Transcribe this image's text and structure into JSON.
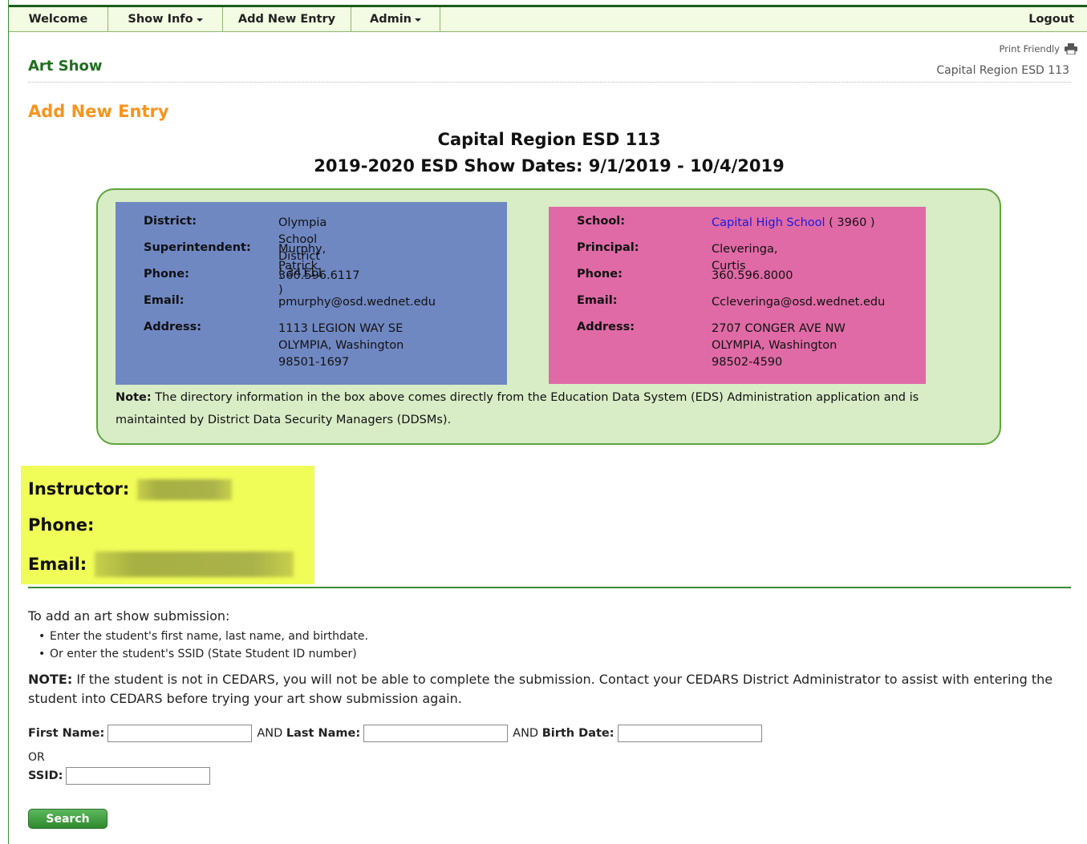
{
  "nav": {
    "welcome": "Welcome",
    "show_info": "Show Info",
    "add_new_entry": "Add New Entry",
    "admin": "Admin",
    "logout": "Logout"
  },
  "header": {
    "print_friendly": "Print Friendly",
    "site_title": "Art Show",
    "region": "Capital Region ESD 113"
  },
  "page": {
    "title": "Add New Entry",
    "heading1": "Capital Region ESD 113",
    "heading2": "2019-2020 ESD Show Dates: 9/1/2019 - 10/4/2019"
  },
  "district": {
    "district_label": "District:",
    "district_value": "Olympia School District ( 34111 )",
    "superintendent_label": "Superintendent:",
    "superintendent_value": "Murphy, Patrick",
    "phone_label": "Phone:",
    "phone_value": "360.596.6117",
    "email_label": "Email:",
    "email_value": "pmurphy@osd.wednet.edu",
    "address_label": "Address:",
    "address_value": "1113 LEGION WAY SE\nOLYMPIA,   Washington\n98501-1697"
  },
  "school": {
    "school_label": "School:",
    "school_name": "Capital High School",
    "school_code": " ( 3960 )",
    "principal_label": "Principal:",
    "principal_value": "Cleveringa, Curtis",
    "phone_label": "Phone:",
    "phone_value": "360.596.8000",
    "email_label": "Email:",
    "email_value": "Ccleveringa@osd.wednet.edu",
    "address_label": "Address:",
    "address_value": "2707 CONGER AVE NW\nOLYMPIA,   Washington\n98502-4590"
  },
  "note": {
    "label": "Note:",
    "text": " The directory information in the box above comes directly from the Education Data System (EDS) Administration application and is maintainted by District Data Security Managers (DDSMs)."
  },
  "instructor": {
    "instructor_label": "Instructor:",
    "phone_label": "Phone:",
    "email_label": "Email:"
  },
  "instructions": {
    "intro": "To add an art show submission:",
    "bullet1": "Enter the student's first name, last name, and birthdate.",
    "bullet2": "Or enter the student's SSID (State Student ID number)",
    "note_label": "NOTE:",
    "note_text": " If the student is not in CEDARS, you will not be able to complete the submission. Contact your CEDARS District Administrator to assist with entering the student into CEDARS before trying your art show submission again."
  },
  "form": {
    "first_name_label": "First Name:",
    "and1": "AND",
    "last_name_label": "Last Name:",
    "and2": "AND",
    "birth_date_label": "Birth Date:",
    "or": "OR",
    "ssid_label": "SSID:",
    "first_name_value": "",
    "last_name_value": "",
    "birth_date_value": "",
    "ssid_value": "",
    "search_button": "Search"
  },
  "colors": {
    "site_green": "#1f6e1f",
    "title_orange": "#f7941d",
    "district_panel": "#7088c2",
    "school_panel": "#e06aa6",
    "directory_box": "#d8ecc6",
    "instructor_highlight": "#f0fc58"
  }
}
